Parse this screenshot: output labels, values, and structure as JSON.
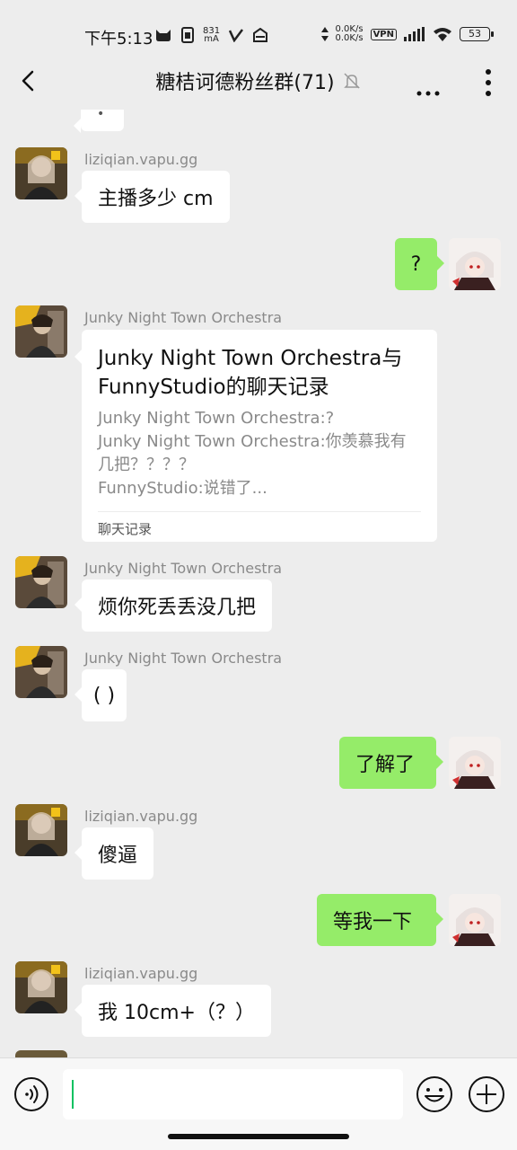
{
  "status_bar": {
    "time": "下午5:13",
    "data_speed_up": "0.0K/s",
    "data_speed_down": "0.0K/s",
    "vpn": "VPN",
    "mA": "831",
    "battery": "53"
  },
  "header": {
    "title": "糖桔诃德粉丝群(71)"
  },
  "messages": [
    {
      "side": "left",
      "sender": "liziqian.vapu.gg",
      "text": "主播多少 cm"
    },
    {
      "side": "right",
      "text": "?"
    },
    {
      "side": "left",
      "sender": "Junky Night Town Orchestra",
      "type": "card",
      "card_title": "Junky Night Town Orchestra与FunnyStudio的聊天记录",
      "card_lines": [
        "Junky Night Town Orchestra:?",
        "Junky Night Town Orchestra:你羡慕我有几把？？？？",
        "FunnyStudio:说错了..."
      ],
      "card_footer": "聊天记录"
    },
    {
      "side": "left",
      "sender": "Junky Night Town Orchestra",
      "text": "烦你死丢丢没几把"
    },
    {
      "side": "left",
      "sender": "Junky Night Town Orchestra",
      "text": "( )"
    },
    {
      "side": "right",
      "text": "了解了"
    },
    {
      "side": "left",
      "sender": "liziqian.vapu.gg",
      "text": "傻逼"
    },
    {
      "side": "right",
      "text": "等我一下"
    },
    {
      "side": "left",
      "sender": "liziqian.vapu.gg",
      "text": "我 10cm+（？）"
    }
  ],
  "input": {
    "value": ""
  },
  "colors": {
    "background": "#ededed",
    "my_bubble": "#95ec69",
    "their_bubble": "#ffffff",
    "cursor": "#07c160"
  },
  "icons": {
    "back": "back-arrow-icon",
    "mute": "mute-bell-icon",
    "more": "more-icon",
    "menu": "vertical-dots-icon",
    "voice": "voice-icon",
    "emoji": "emoji-icon",
    "plus": "plus-icon"
  }
}
